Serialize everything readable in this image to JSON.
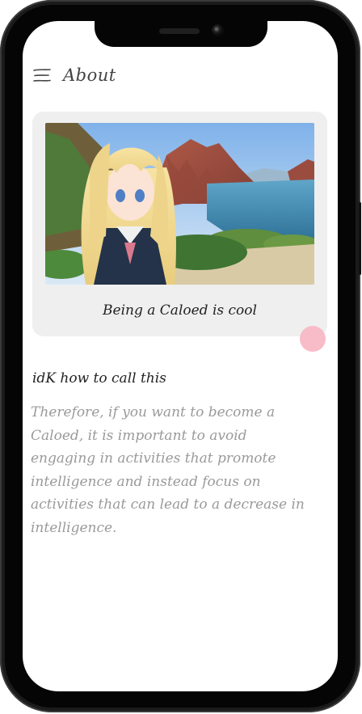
{
  "header": {
    "title": "About",
    "menu_icon": "hamburger-menu-icon"
  },
  "card": {
    "image_description": "anime girl with long blonde hair in sailor uniform on coastal cliff overlooking bay",
    "caption": "Being a Caloed is cool"
  },
  "fab": {
    "color": "#f8bcc8"
  },
  "section": {
    "title": "idK how to call this",
    "body": "Therefore, if you want to become a Caloed, it is important to avoid engaging in activities that promote intelligence and instead focus on activities that can lead to a decrease in intelligence."
  },
  "colors": {
    "frame": "#1b1b1b",
    "screen": "#ffffff",
    "card_bg": "#efefef",
    "body_text": "#9a9a9a"
  }
}
